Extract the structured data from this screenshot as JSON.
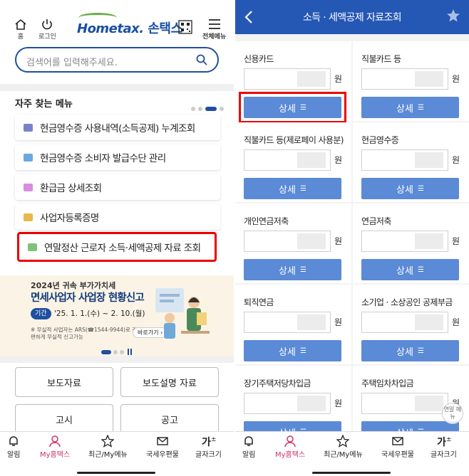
{
  "left": {
    "header": {
      "home_label": "홈",
      "login_label": "로그인",
      "logo_en": "Hometax.",
      "logo_ko": "손택스",
      "menu_label": "전체메뉴"
    },
    "search": {
      "placeholder": "검색어를 입력해주세요."
    },
    "frequent": {
      "title": "자주 찾는 메뉴",
      "items": [
        {
          "label": "현금영수증 사용내역(소득공제) 누계조회",
          "icon_color": "#7a83c8"
        },
        {
          "label": "현금영수증 소비자 발급수단 관리",
          "icon_color": "#6aa8e0"
        },
        {
          "label": "환급금 상세조회",
          "icon_color": "#d78ee0"
        },
        {
          "label": "사업자등록증명",
          "icon_color": "#e8b84a"
        },
        {
          "label": "연말정산 근로자 소득·세액공제 자료 조회",
          "icon_color": "#7fc27a"
        }
      ]
    },
    "banner": {
      "line1": "2024년 귀속 부가가치세",
      "line2": "면세사업자 사업장 현황신고",
      "period_tag": "기간",
      "period": "'25. 1. 1.(수) ~ 2. 10.(월)",
      "note": "※ 무실적 사업자는 ARS(☎1544-9944)로 간편하게 무실적 신고가능",
      "go_label": "바로가기 ›"
    },
    "notices": [
      "보도자료",
      "보도설명 자료",
      "고시",
      "공고"
    ]
  },
  "bottom_nav": [
    "알림",
    "My홈택스",
    "최근/My메뉴",
    "국세우편물",
    "글자크기"
  ],
  "right": {
    "title": "소득 · 세액공제 자료조회",
    "unit": "원",
    "detail_label": "상세",
    "overlay_label": "연말 메뉴",
    "cells": [
      "신용카드",
      "직불카드 등",
      "직불카드 등(제로페이 사용분)",
      "현금영수증",
      "개인연금저축",
      "연금저축",
      "퇴직연금",
      "소기업 · 소상공인 공제부금",
      "장기주택저당차입금",
      "주택임차차입금"
    ]
  }
}
